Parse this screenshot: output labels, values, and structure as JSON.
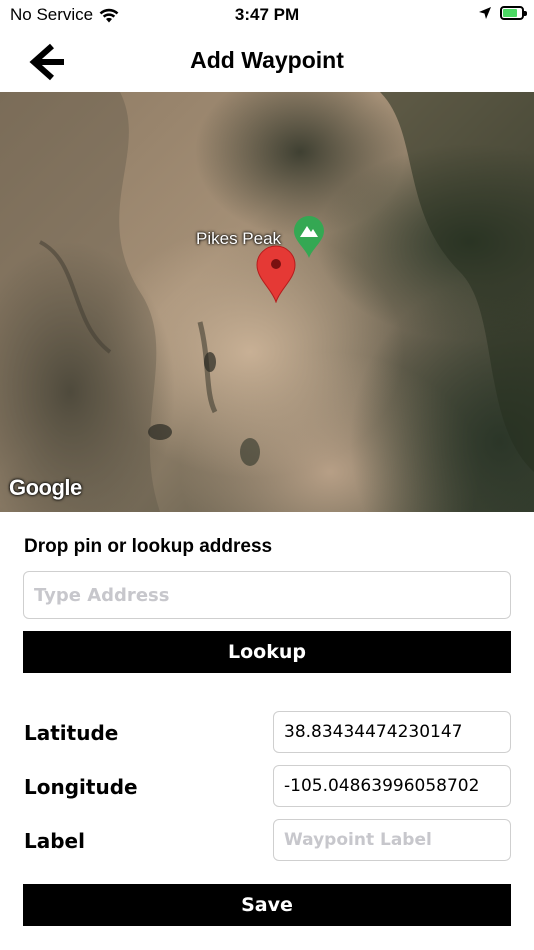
{
  "status_bar": {
    "carrier": "No Service",
    "time": "3:47 PM",
    "wifi_icon": "wifi-icon",
    "location_icon": "location-arrow-icon",
    "battery_icon": "battery-charging-icon",
    "battery_color": "#4cd964"
  },
  "nav": {
    "title": "Add Waypoint",
    "back_icon": "chevron-left-icon"
  },
  "map": {
    "place_label": "Pikes Peak",
    "peak_marker_color": "#34a853",
    "pin_color": "#e53935",
    "attribution": "Google"
  },
  "form": {
    "heading": "Drop pin or lookup address",
    "address_placeholder": "Type Address",
    "address_value": "",
    "lookup_label": "Lookup",
    "latitude_label": "Latitude",
    "latitude_value": "38.83434474230147",
    "longitude_label": "Longitude",
    "longitude_value": "-105.04863996058702",
    "label_label": "Label",
    "label_placeholder": "Waypoint Label",
    "label_value": "",
    "save_label": "Save"
  }
}
